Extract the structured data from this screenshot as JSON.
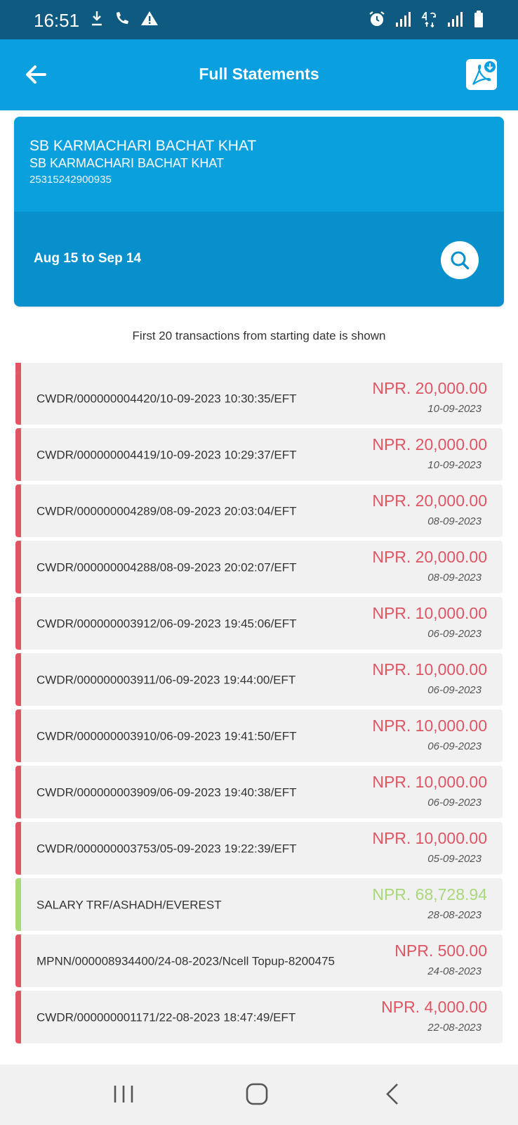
{
  "status_bar": {
    "time": "16:51",
    "left_icons": [
      "download-icon",
      "wifi-calling-icon",
      "warning-icon"
    ],
    "right_icons": [
      "alarm-icon",
      "signal-icon",
      "4g-icon",
      "signal-icon",
      "battery-icon"
    ]
  },
  "app_bar": {
    "title": "Full Statements",
    "icons": {
      "back": "arrow-left-icon",
      "pdf": "pdf-download-icon"
    }
  },
  "account": {
    "name_primary": "SB KARMACHARI BACHAT KHAT",
    "name_secondary": "SB KARMACHARI BACHAT KHAT",
    "account_number": "25315242900935",
    "date_range": "Aug 15 to Sep 14"
  },
  "notice": "First 20 transactions from starting date is shown",
  "transactions": [
    {
      "description": "CWDR/000000004420/10-09-2023 10:30:35/EFT",
      "amount": "NPR. 20,000.00",
      "date": "10-09-2023",
      "type": "debit"
    },
    {
      "description": "CWDR/000000004419/10-09-2023 10:29:37/EFT",
      "amount": "NPR. 20,000.00",
      "date": "10-09-2023",
      "type": "debit"
    },
    {
      "description": "CWDR/000000004289/08-09-2023 20:03:04/EFT",
      "amount": "NPR. 20,000.00",
      "date": "08-09-2023",
      "type": "debit"
    },
    {
      "description": "CWDR/000000004288/08-09-2023 20:02:07/EFT",
      "amount": "NPR. 20,000.00",
      "date": "08-09-2023",
      "type": "debit"
    },
    {
      "description": "CWDR/000000003912/06-09-2023 19:45:06/EFT",
      "amount": "NPR. 10,000.00",
      "date": "06-09-2023",
      "type": "debit"
    },
    {
      "description": "CWDR/000000003911/06-09-2023 19:44:00/EFT",
      "amount": "NPR. 10,000.00",
      "date": "06-09-2023",
      "type": "debit"
    },
    {
      "description": "CWDR/000000003910/06-09-2023 19:41:50/EFT",
      "amount": "NPR. 10,000.00",
      "date": "06-09-2023",
      "type": "debit"
    },
    {
      "description": "CWDR/000000003909/06-09-2023 19:40:38/EFT",
      "amount": "NPR. 10,000.00",
      "date": "06-09-2023",
      "type": "debit"
    },
    {
      "description": "CWDR/000000003753/05-09-2023 19:22:39/EFT",
      "amount": "NPR. 10,000.00",
      "date": "05-09-2023",
      "type": "debit"
    },
    {
      "description": "SALARY TRF/ASHADH/EVEREST",
      "amount": "NPR. 68,728.94",
      "date": "28-08-2023",
      "type": "credit"
    },
    {
      "description": "MPNN/000008934400/24-08-2023/Ncell Topup-8200475",
      "amount": "NPR. 500.00",
      "date": "24-08-2023",
      "type": "debit"
    },
    {
      "description": "CWDR/000000001171/22-08-2023 18:47:49/EFT",
      "amount": "NPR. 4,000.00",
      "date": "22-08-2023",
      "type": "debit"
    }
  ],
  "colors": {
    "status_bar": "#0e5a80",
    "app_bar": "#0a9fde",
    "card_top": "#0aa0de",
    "card_bottom": "#0890cc",
    "debit": "#e05563",
    "credit": "#a8d87a"
  },
  "nav_bar": {
    "icons": [
      "recent-apps-icon",
      "home-icon",
      "back-icon"
    ]
  }
}
